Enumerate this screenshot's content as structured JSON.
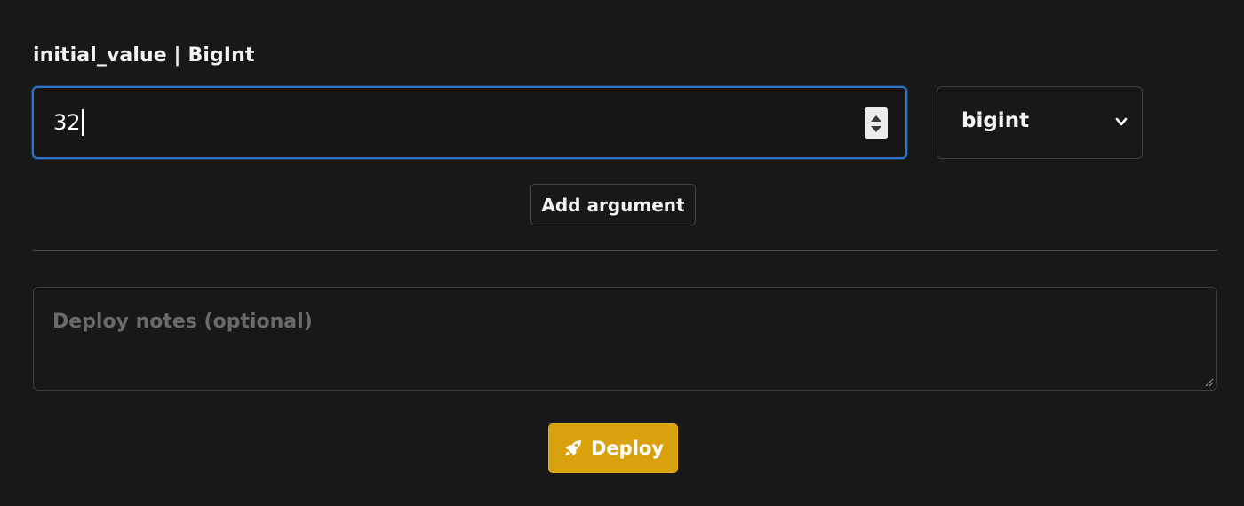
{
  "argument": {
    "label": "initial_value | BigInt",
    "value": "32",
    "type_select": {
      "selected": "bigint"
    }
  },
  "actions": {
    "add_argument_label": "Add argument",
    "deploy_label": "Deploy"
  },
  "notes": {
    "placeholder": "Deploy notes (optional)"
  },
  "colors": {
    "background": "#181818",
    "focus_border": "#2f73c9",
    "deploy_button": "#d9a20c",
    "placeholder_text": "#6a6a6a"
  },
  "icons": {
    "deploy": "rocket-icon",
    "select": "chevron-down-icon",
    "stepper": "number-stepper",
    "resize": "resize-handle-icon"
  }
}
